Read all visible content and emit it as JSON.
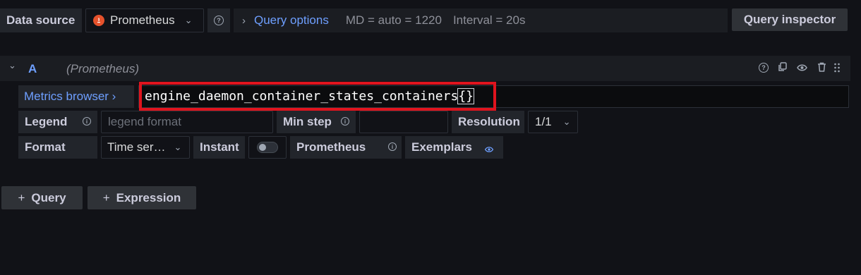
{
  "toolbar": {
    "datasource_label": "Data source",
    "datasource_value": "Prometheus",
    "query_options_label": "Query options",
    "md_text": "MD = auto = 1220",
    "interval_text": "Interval = 20s",
    "query_inspector_label": "Query inspector"
  },
  "query": {
    "ref_id": "A",
    "datasource_name": "(Prometheus)",
    "metrics_browser_label": "Metrics browser ›",
    "expression_main": "engine_daemon_container_states_containers",
    "expression_braces": "{}",
    "legend_label": "Legend",
    "legend_placeholder": "legend format",
    "min_step_label": "Min step",
    "resolution_label": "Resolution",
    "resolution_value": "1/1",
    "format_label": "Format",
    "format_value": "Time ser…",
    "instant_label": "Instant",
    "prometheus_label": "Prometheus",
    "exemplars_label": "Exemplars"
  },
  "actions": {
    "add_query_label": "Query",
    "add_expression_label": "Expression"
  },
  "colors": {
    "accent_blue": "#6e9fff",
    "highlight_red": "#e0141e",
    "prometheus_orange": "#e6522c"
  }
}
